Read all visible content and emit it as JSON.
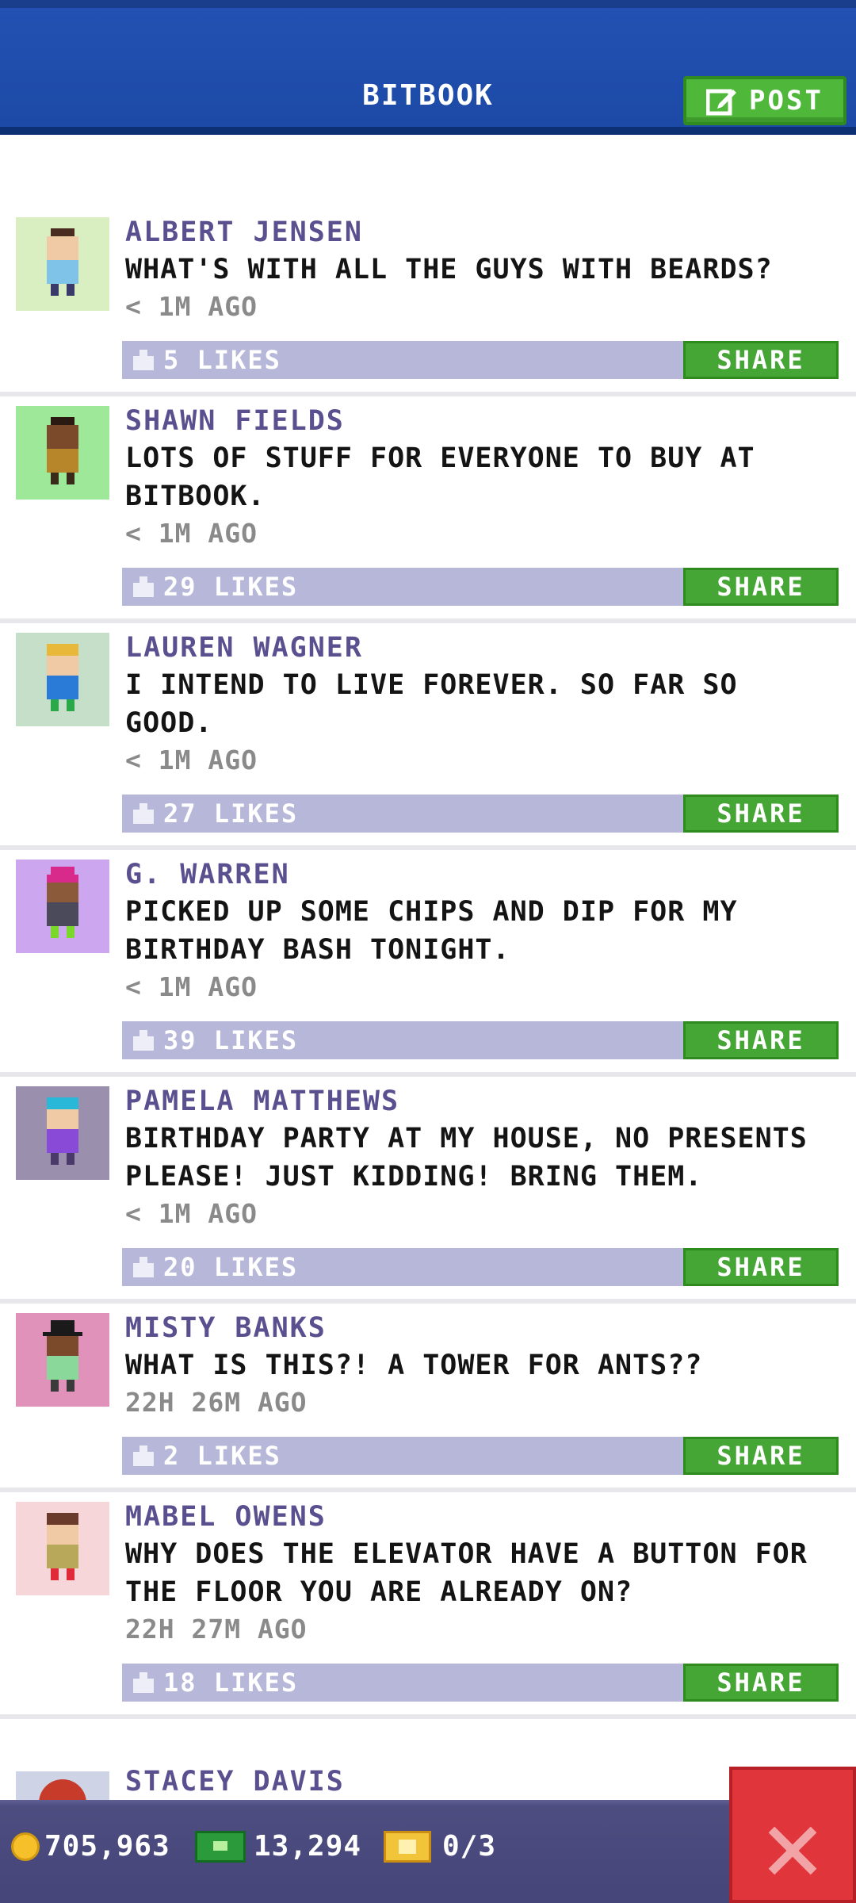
{
  "header": {
    "title": "BITBOOK",
    "post_label": "POST"
  },
  "share_label": "SHARE",
  "posts": [
    {
      "author": "ALBERT JENSEN",
      "text": "WHAT'S WITH ALL THE GUYS WITH BEARDS?",
      "time": "< 1M AGO",
      "likes": "5 LIKES",
      "avatar_bg": "#d9efc1"
    },
    {
      "author": "SHAWN FIELDS",
      "text": "LOTS OF STUFF FOR EVERYONE TO BUY AT BITBOOK.",
      "time": "< 1M AGO",
      "likes": "29 LIKES",
      "avatar_bg": "#9ee89a"
    },
    {
      "author": "LAUREN WAGNER",
      "text": "I INTEND TO LIVE FOREVER. SO FAR SO GOOD.",
      "time": "< 1M AGO",
      "likes": "27 LIKES",
      "avatar_bg": "#c5dfc8"
    },
    {
      "author": "G. WARREN",
      "text": "PICKED UP SOME CHIPS AND DIP FOR MY BIRTHDAY BASH TONIGHT.",
      "time": "< 1M AGO",
      "likes": "39 LIKES",
      "avatar_bg": "#cca6ef"
    },
    {
      "author": "PAMELA MATTHEWS",
      "text": "BIRTHDAY PARTY AT MY HOUSE, NO PRESENTS PLEASE! JUST KIDDING! BRING THEM.",
      "time": "< 1M AGO",
      "likes": "20 LIKES",
      "avatar_bg": "#9b8fae"
    },
    {
      "author": "MISTY BANKS",
      "text": "WHAT IS THIS?! A TOWER FOR ANTS??",
      "time": "22H 26M AGO",
      "likes": "2 LIKES",
      "avatar_bg": "#e192ba"
    },
    {
      "author": "MABEL OWENS",
      "text": "WHY DOES THE ELEVATOR HAVE A BUTTON FOR THE FLOOR YOU ARE ALREADY ON?",
      "time": "22H 27M AGO",
      "likes": "18 LIKES",
      "avatar_bg": "#f6d6d8"
    }
  ],
  "partial_post": {
    "author": "STACEY DAVIS"
  },
  "footer": {
    "coins": "705,963",
    "bux": "13,294",
    "tickets": "0/3"
  },
  "icons": {
    "post": "edit-icon",
    "coin": "coin-icon",
    "cash": "cash-icon",
    "ticket": "ticket-icon",
    "close": "close-icon",
    "like": "thumbs-up-icon"
  },
  "colors": {
    "header": "#1d4aa6",
    "accent_green": "#45a535",
    "like_bar": "#b7b8d9",
    "author": "#5a4f8f",
    "close": "#e0353a",
    "footer": "#4d4d80"
  }
}
